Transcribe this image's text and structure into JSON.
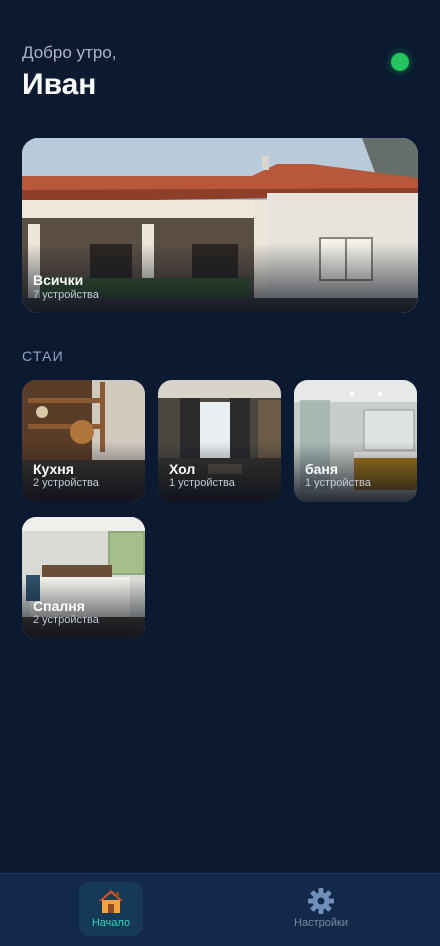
{
  "header": {
    "greeting": "Добро утро,",
    "user_name": "Иван",
    "status_color": "#22c55e"
  },
  "hero": {
    "title": "Всички",
    "subtitle": "7 устройства"
  },
  "rooms_section": {
    "label": "СТАИ",
    "rooms": [
      {
        "title": "Кухня",
        "subtitle": "2 устройства"
      },
      {
        "title": "Хол",
        "subtitle": "1 устройства"
      },
      {
        "title": "баня",
        "subtitle": "1 устройства"
      },
      {
        "title": "Спалня",
        "subtitle": "2 устройства"
      }
    ]
  },
  "nav": {
    "home_label": "Начало",
    "home_icon": "house-icon",
    "settings_label": "Настройки",
    "settings_icon": "gear-icon",
    "accent_color": "#2dd4bf"
  }
}
